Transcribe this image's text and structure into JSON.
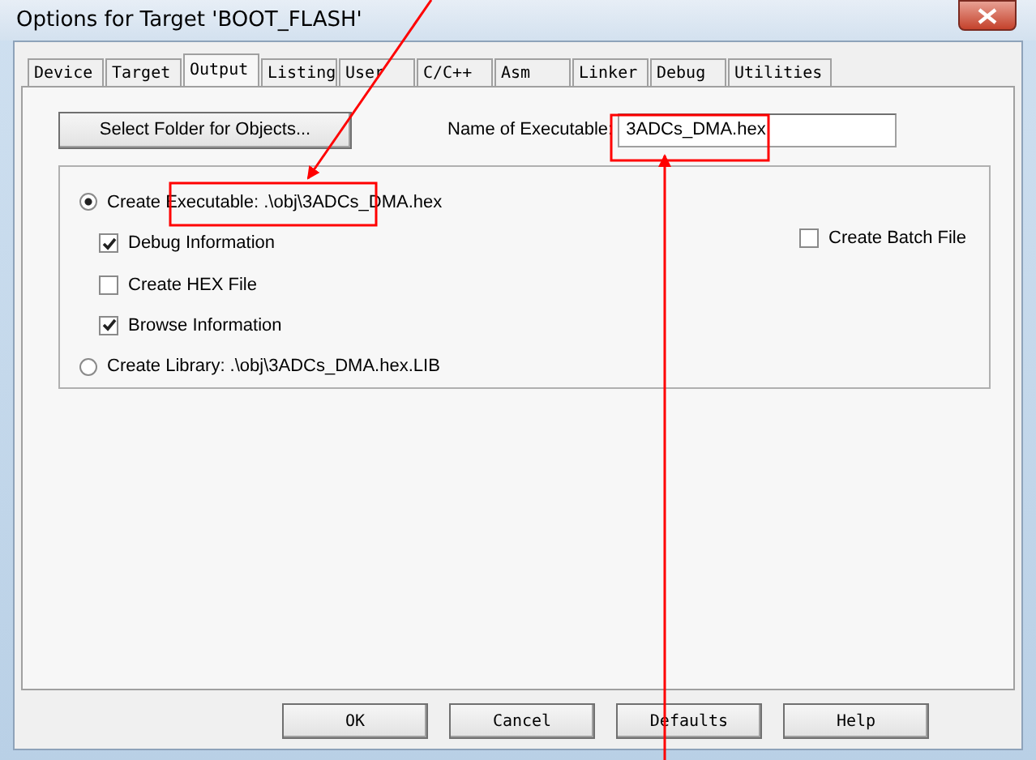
{
  "window": {
    "title": "Options for Target 'BOOT_FLASH'"
  },
  "tabs": [
    {
      "label": "Device",
      "selected": false
    },
    {
      "label": "Target",
      "selected": false
    },
    {
      "label": "Output",
      "selected": true
    },
    {
      "label": "Listing",
      "selected": false
    },
    {
      "label": "User",
      "selected": false
    },
    {
      "label": "C/C++",
      "selected": false
    },
    {
      "label": "Asm",
      "selected": false
    },
    {
      "label": "Linker",
      "selected": false
    },
    {
      "label": "Debug",
      "selected": false
    },
    {
      "label": "Utilities",
      "selected": false
    }
  ],
  "select_folder_button": "Select Folder for Objects...",
  "name_of_executable": {
    "label": "Name of Executable:",
    "value": "3ADCs_DMA.hex"
  },
  "options": [
    {
      "kind": "radio",
      "label": "Create Executable:  .\\obj\\3ADCs_DMA.hex",
      "selected": true
    },
    {
      "kind": "checkbox",
      "label": "Debug Information",
      "checked": true
    },
    {
      "kind": "checkbox",
      "label": "Create HEX File",
      "checked": false
    },
    {
      "kind": "checkbox",
      "label": "Browse Information",
      "checked": true
    },
    {
      "kind": "radio",
      "label": "Create Library:  .\\obj\\3ADCs_DMA.hex.LIB",
      "selected": false
    }
  ],
  "create_batch_file": {
    "label": "Create Batch File",
    "checked": false
  },
  "buttons": [
    "OK",
    "Cancel",
    "Defaults",
    "Help"
  ]
}
